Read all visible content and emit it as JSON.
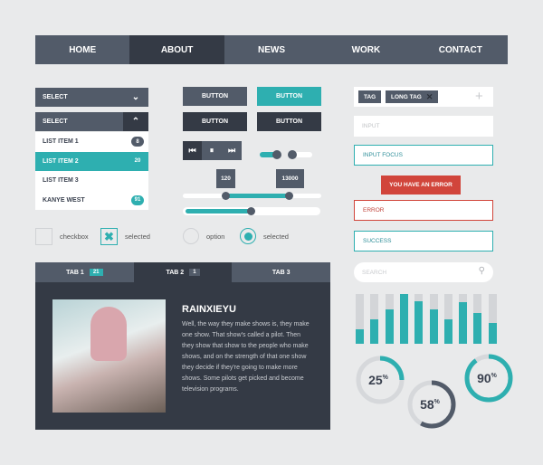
{
  "nav": {
    "items": [
      "HOME",
      "ABOUT",
      "NEWS",
      "WORK",
      "CONTACT"
    ],
    "active": "ABOUT"
  },
  "select1": {
    "label": "SELECT"
  },
  "select2": {
    "label": "SELECT",
    "items": [
      {
        "label": "LIST ITEM 1",
        "badge": "8"
      },
      {
        "label": "LIST ITEM 2",
        "badge": "20"
      },
      {
        "label": "LIST ITEM 3",
        "badge": ""
      },
      {
        "label": "KANYE WEST",
        "badge": "91"
      }
    ]
  },
  "buttons": [
    "BUTTON",
    "BUTTON",
    "BUTTON",
    "BUTTON"
  ],
  "range": {
    "low": "120",
    "high": "13000",
    "progress_fraction": 0.5
  },
  "toggles": {
    "first_on": true,
    "second_on": false
  },
  "checkbox": {
    "label": "checkbox",
    "selected_label": "selected"
  },
  "radio": {
    "label": "option",
    "selected_label": "selected"
  },
  "tags": [
    "TAG",
    "LONG TAG"
  ],
  "inputs": {
    "placeholder": "INPUT",
    "focus": "INPUT FOCUS",
    "error_tooltip": "YOU HAVE AN ERROR",
    "error": "ERROR",
    "success": "SUCCESS",
    "search_placeholder": "SEARCH"
  },
  "tabs": [
    {
      "label": "TAB 1",
      "badge": "21"
    },
    {
      "label": "TAB 2",
      "badge": "1"
    },
    {
      "label": "TAB 3",
      "badge": ""
    }
  ],
  "profile": {
    "name": "RAINXIEYU",
    "text": "Well, the way they make shows is, they make one show. That show's called a pilot. Then they show that show to the people who make shows, and on the strength of that one show they decide if they're going to make more shows. Some pilots get picked and become television programs."
  },
  "bars": [
    0.3,
    0.5,
    0.7,
    1.0,
    0.86,
    0.7,
    0.5,
    0.83,
    0.62,
    0.42
  ],
  "donuts": [
    {
      "value": 25,
      "color": "#2eafb0"
    },
    {
      "value": 58,
      "color": "#525b69"
    },
    {
      "value": 90,
      "color": "#2eafb0"
    }
  ],
  "colors": {
    "accent": "#2eafb0",
    "dark": "#343a45",
    "slate": "#525b69",
    "error": "#d1453b"
  }
}
